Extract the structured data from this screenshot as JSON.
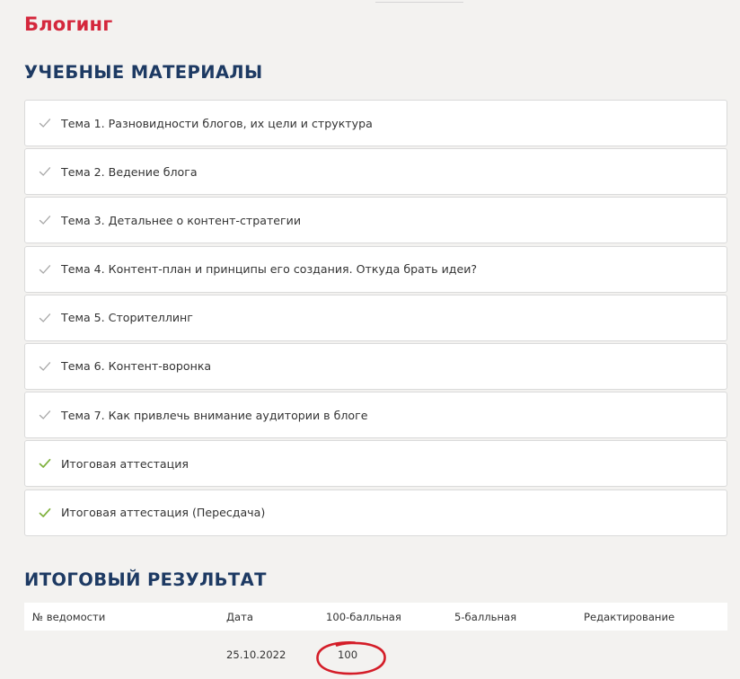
{
  "course": {
    "title": "Блогинг"
  },
  "materials": {
    "heading": "УЧЕБНЫЕ МАТЕРИАЛЫ",
    "items": [
      {
        "label": "Тема 1. Разновидности блогов, их цели и структура",
        "done": false
      },
      {
        "label": "Тема 2. Ведение блога",
        "done": false
      },
      {
        "label": "Тема 3. Детальнее о контент-стратегии",
        "done": false
      },
      {
        "label": "Тема 4. Контент-план и принципы его создания. Откуда брать идеи?",
        "done": false
      },
      {
        "label": "Тема 5. Сторителлинг",
        "done": false
      },
      {
        "label": "Тема 6. Контент-воронка",
        "done": false
      },
      {
        "label": "Тема 7. Как привлечь внимание аудитории в блоге",
        "done": false
      },
      {
        "label": "Итоговая аттестация",
        "done": true
      },
      {
        "label": "Итоговая аттестация (Пересдача)",
        "done": true
      }
    ]
  },
  "results": {
    "heading": "ИТОГОВЫЙ РЕЗУЛЬТАТ",
    "columns": [
      "№ ведомости",
      "Дата",
      "100-балльная",
      "5-балльная",
      "Редактирование"
    ],
    "rows": [
      {
        "number": "",
        "date": "25.10.2022",
        "score100": "100",
        "score5": "",
        "edit": ""
      }
    ]
  },
  "colors": {
    "background": "#f3f2f0",
    "title_red": "#d4273c",
    "heading_navy": "#1d3a63",
    "check_gray": "#a7a7a7",
    "check_green": "#7fb13d",
    "highlight_red": "#d41d28"
  }
}
